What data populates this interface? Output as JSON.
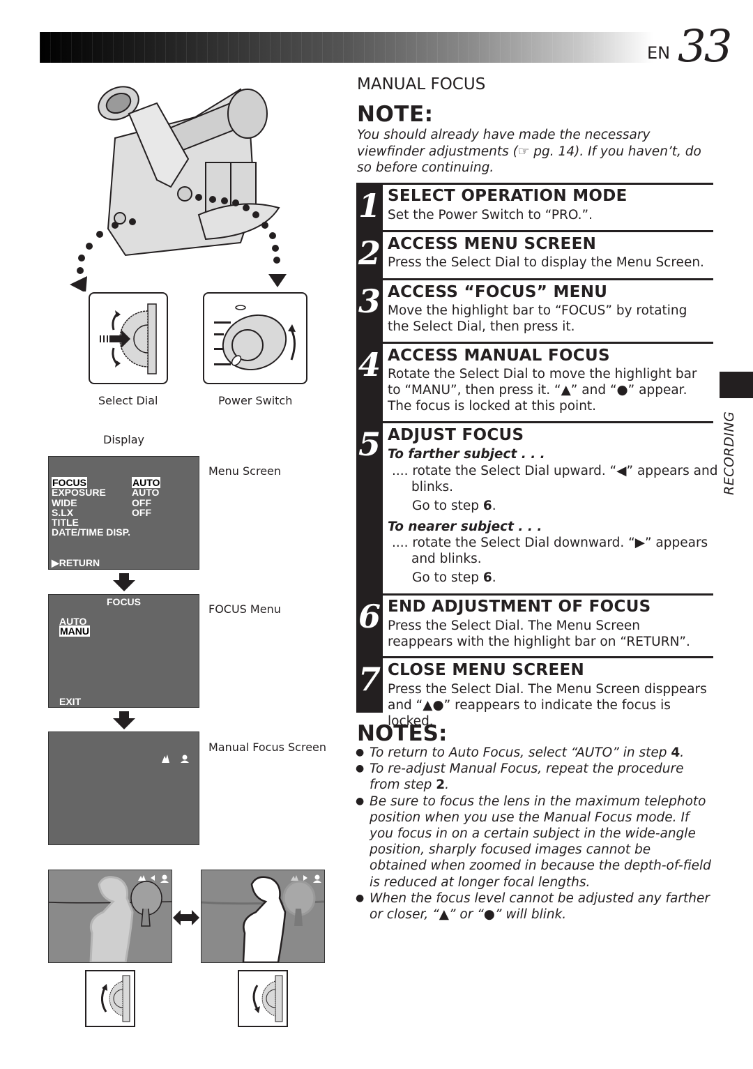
{
  "header": {
    "lang_code": "EN",
    "page_number": "33"
  },
  "section_title": "MANUAL FOCUS",
  "note": {
    "title": "NOTE:",
    "text": "You should already have made the necessary viewfinder adjustments (☞ pg. 14). If you haven’t, do so before continuing."
  },
  "steps": [
    {
      "num": "1",
      "title": "SELECT OPERATION MODE",
      "body": "Set the Power Switch to “PRO.”."
    },
    {
      "num": "2",
      "title": "ACCESS MENU SCREEN",
      "body": "Press the Select Dial to display the Menu Screen."
    },
    {
      "num": "3",
      "title": "ACCESS “FOCUS” MENU",
      "body": "Move the highlight bar to “FOCUS” by rotating the Select Dial, then press it."
    },
    {
      "num": "4",
      "title": "ACCESS MANUAL FOCUS",
      "body": "Rotate the Select Dial to move the highlight bar to “MANU”, then press it. “▲” and “●” appear. The focus is locked at this point."
    },
    {
      "num": "5",
      "title": "ADJUST FOCUS",
      "farther_head": "To farther subject . . .",
      "farther_body": ".... rotate the Select Dial upward. “◀” appears and blinks.",
      "farther_goto": "Go to step",
      "farther_goto_num": "6",
      "nearer_head": "To nearer subject . . .",
      "nearer_body": ".... rotate the Select Dial downward. “▶” appears and blinks.",
      "nearer_goto": "Go to step",
      "nearer_goto_num": "6"
    },
    {
      "num": "6",
      "title": "END ADJUSTMENT OF FOCUS",
      "body": "Press the Select Dial. The Menu Screen reappears with the highlight bar on “RETURN”."
    },
    {
      "num": "7",
      "title": "CLOSE MENU SCREEN",
      "body": "Press the Select Dial. The Menu Screen disppears and “▲●” reappears to indicate the focus is locked."
    }
  ],
  "notes": {
    "title": "NOTES:",
    "items": [
      {
        "pre": "To return to Auto Focus, select “AUTO” in step ",
        "bold": "4",
        "post": "."
      },
      {
        "pre": "To re-adjust Manual Focus, repeat the procedure from step ",
        "bold": "2",
        "post": "."
      },
      {
        "pre": "Be sure to focus the lens in the maximum telephoto position when you use the Manual Focus mode. If you focus in on a certain subject in the wide-angle position, sharply focused images cannot be obtained when zoomed in because the depth-of-field is reduced at longer focal lengths.",
        "bold": "",
        "post": ""
      },
      {
        "pre": "When the focus level cannot be adjusted any farther or closer, “▲” or “●” will blink.",
        "bold": "",
        "post": ""
      }
    ]
  },
  "side_tab": "RECORDING",
  "figures": {
    "select_dial_caption": "Select Dial",
    "power_switch_caption": "Power Switch",
    "display_caption": "Display",
    "menu_screen_caption": "Menu Screen",
    "focus_menu_caption": "FOCUS Menu",
    "manual_focus_caption": "Manual Focus Screen"
  },
  "menu_screen": {
    "rows": [
      {
        "item": "FOCUS",
        "value": "AUTO",
        "highlight": true
      },
      {
        "item": "EXPOSURE",
        "value": "AUTO"
      },
      {
        "item": "WIDE",
        "value": "OFF"
      },
      {
        "item": "S.LX",
        "value": "OFF"
      },
      {
        "item": "TITLE",
        "value": ""
      },
      {
        "item": "DATE/TIME DISP.",
        "value": ""
      }
    ],
    "return_label": "▶RETURN"
  },
  "focus_menu": {
    "title": "FOCUS",
    "options": [
      "AUTO",
      "MANU"
    ],
    "selected": "MANU",
    "exit_label": "EXIT"
  }
}
